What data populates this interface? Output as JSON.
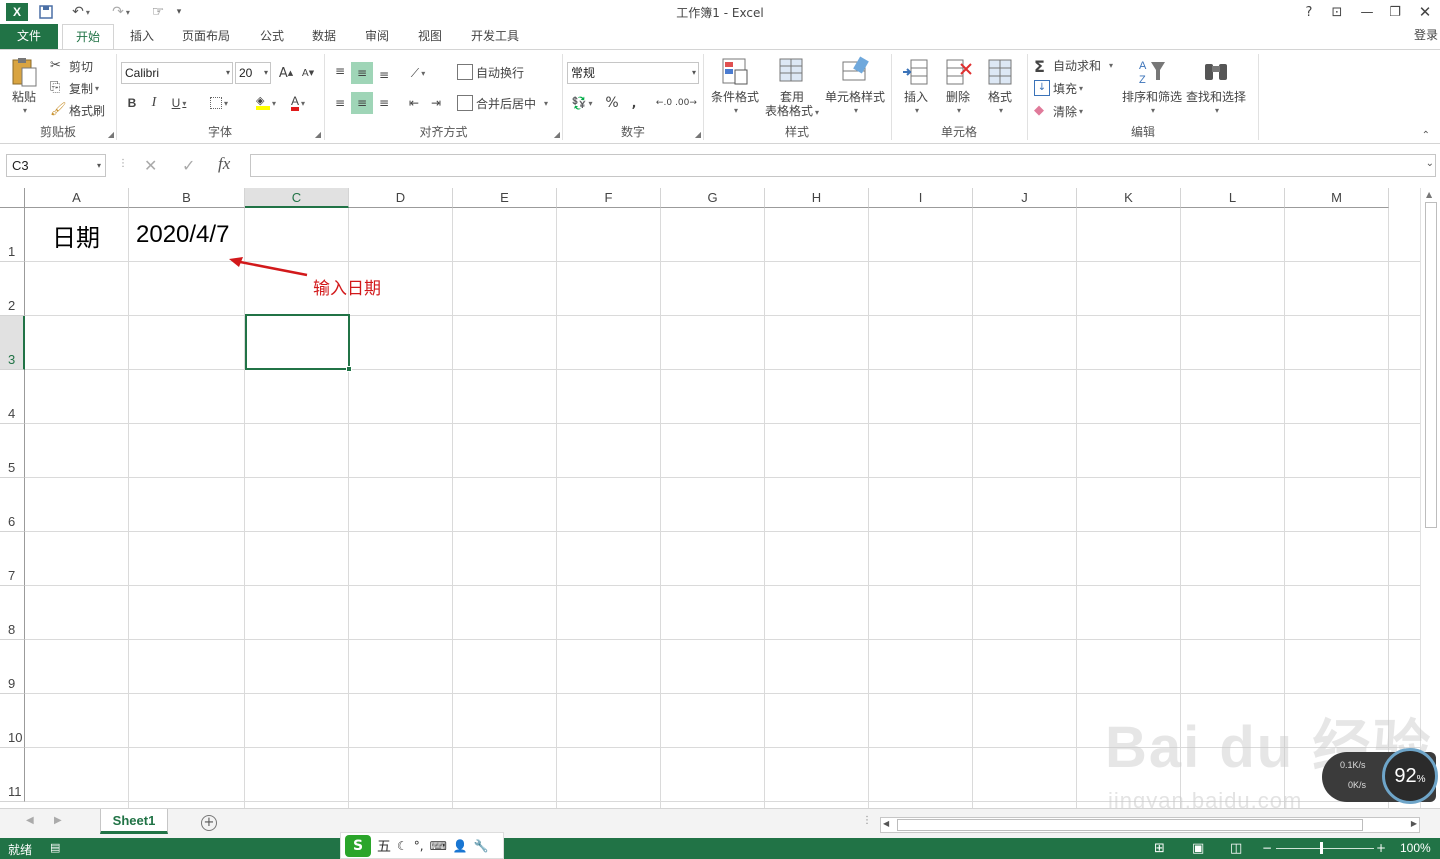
{
  "window": {
    "title": "工作簿1 - Excel",
    "help": "?",
    "login": "登录"
  },
  "tabs": [
    "文件",
    "开始",
    "插入",
    "页面布局",
    "公式",
    "数据",
    "审阅",
    "视图",
    "开发工具"
  ],
  "ribbon": {
    "clipboard": {
      "label": "剪贴板",
      "paste": "粘贴",
      "cut": "剪切",
      "copy": "复制",
      "format_painter": "格式刷"
    },
    "font": {
      "label": "字体",
      "name": "Calibri",
      "size": "20",
      "bold": "B",
      "italic": "I",
      "underline": "U",
      "grow": "A",
      "shrink": "A"
    },
    "alignment": {
      "label": "对齐方式",
      "wrap": "自动换行",
      "merge": "合并后居中"
    },
    "number": {
      "label": "数字",
      "format": "常规",
      "percent": "%",
      "comma": ","
    },
    "styles": {
      "label": "样式",
      "conditional": "条件格式",
      "table_line1": "套用",
      "table_line2": "表格格式",
      "cell_styles": "单元格样式"
    },
    "cells": {
      "label": "单元格",
      "insert": "插入",
      "delete": "删除",
      "format": "格式"
    },
    "editing": {
      "label": "编辑",
      "autosum": "自动求和",
      "fill": "填充",
      "clear": "清除",
      "sort": "排序和筛选",
      "find": "查找和选择"
    }
  },
  "formula_bar": {
    "name_box": "C3",
    "fx": "fx",
    "value": ""
  },
  "grid": {
    "columns": [
      "A",
      "B",
      "C",
      "D",
      "E",
      "F",
      "G",
      "H",
      "I",
      "J",
      "K",
      "L",
      "M"
    ],
    "rows": [
      "1",
      "2",
      "3",
      "4",
      "5",
      "6",
      "7",
      "8",
      "9",
      "10",
      "11"
    ],
    "active_column": "C",
    "active_row": "3",
    "cells": {
      "A1": "日期",
      "B1": "2020/4/7"
    },
    "annotation": "输入日期"
  },
  "sheets": {
    "active": "Sheet1",
    "add": "+"
  },
  "status": {
    "ready": "就绪",
    "zoom": "100%"
  },
  "overlay": {
    "watermark": "Bai du 经验",
    "watermark_url": "jingyan.baidu.com",
    "net_up": "0.1K/s",
    "net_down": "0K/s",
    "net_percent": "92",
    "net_percent_unit": "%",
    "ime_char": "五"
  },
  "colors": {
    "accent": "#217346",
    "annotation": "#d2191b"
  }
}
